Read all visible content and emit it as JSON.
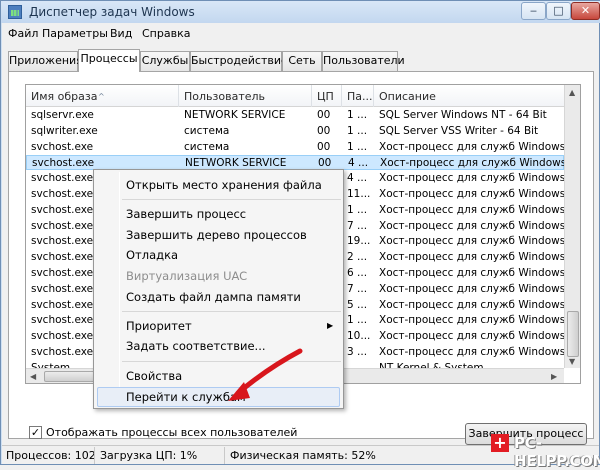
{
  "window": {
    "title": "Диспетчер задач Windows"
  },
  "menu": [
    "Файл",
    "Параметры",
    "Вид",
    "Справка"
  ],
  "tabs": [
    "Приложения",
    "Процессы",
    "Службы",
    "Быстродействие",
    "Сеть",
    "Пользователи"
  ],
  "active_tab": "Процессы",
  "table": {
    "columns": [
      "Имя образа",
      "Пользователь",
      "ЦП",
      "Па...",
      "Описание"
    ],
    "rows": [
      [
        "sqlservr.exe",
        "NETWORK SERVICE",
        "00",
        "1 ...",
        "SQL Server Windows NT - 64 Bit"
      ],
      [
        "sqlwriter.exe",
        "система",
        "00",
        "1 ...",
        "SQL Server VSS Writer - 64 Bit"
      ],
      [
        "svchost.exe",
        "система",
        "00",
        "1 ...",
        "Хост-процесс для служб Windows"
      ],
      [
        "svchost.exe",
        "NETWORK SERVICE",
        "00",
        "4 ...",
        "Хост-процесс для служб Windows"
      ],
      [
        "svchost.exe",
        "",
        "",
        "4 ...",
        "Хост-процесс для служб Windows"
      ],
      [
        "svchost.exe",
        "",
        "",
        "11...",
        "Хост-процесс для служб Windows"
      ],
      [
        "svchost.exe",
        "",
        "",
        "1 ...",
        "Хост-процесс для служб Windows"
      ],
      [
        "svchost.exe",
        "",
        "",
        "7 ...",
        "Хост-процесс для служб Windows"
      ],
      [
        "svchost.exe",
        "",
        "",
        "19...",
        "Хост-процесс для служб Windows"
      ],
      [
        "svchost.exe",
        "",
        "",
        "2 ...",
        "Хост-процесс для служб Windows"
      ],
      [
        "svchost.exe",
        "",
        "",
        "6 ...",
        "Хост-процесс для служб Windows"
      ],
      [
        "svchost.exe",
        "",
        "",
        "7 ...",
        "Хост-процесс для служб Windows"
      ],
      [
        "svchost.exe",
        "",
        "",
        "5 ...",
        "Хост-процесс для служб Windows"
      ],
      [
        "svchost.exe",
        "",
        "",
        "1 ...",
        "Хост-процесс для служб Windows"
      ],
      [
        "svchost.exe",
        "",
        "",
        "10...",
        "Хост-процесс для служб Windows"
      ],
      [
        "svchost.exe",
        "",
        "",
        "3 ...",
        "Хост-процесс для служб Windows"
      ],
      [
        "System",
        "",
        "",
        "",
        "NT Kernel & System"
      ]
    ],
    "selected_row": 3
  },
  "context_menu": {
    "items": [
      "Открыть место хранения файла",
      "Завершить процесс",
      "Завершить дерево процессов",
      "Отладка",
      "Виртуализация UAC",
      "Создать файл дампа памяти",
      "Приоритет",
      "Задать соответствие...",
      "Свойства",
      "Перейти к службам"
    ]
  },
  "show_all_users_label": "Отображать процессы всех пользователей",
  "show_all_users_checked": true,
  "end_process_button": "Завершить процесс",
  "status": {
    "processes": "Процессов: 102",
    "cpu": "Загрузка ЦП: 1%",
    "memory": "Физическая память: 52%"
  },
  "watermark": "PC-HELPP.COM",
  "accent_color": "#e21c23"
}
